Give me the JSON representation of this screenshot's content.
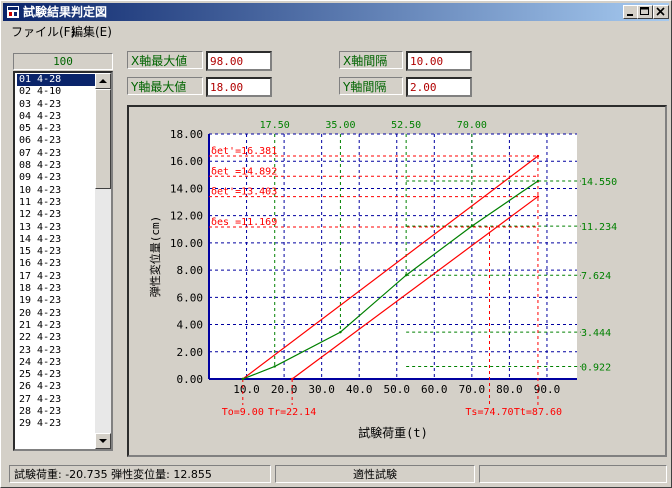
{
  "window": {
    "title": "試験結果判定図"
  },
  "menu": {
    "items": [
      "ファイル(F)",
      "編集(E)"
    ]
  },
  "counter": "100",
  "list": {
    "selected_index": 0,
    "items": [
      "01 4-28",
      "02 4-10",
      "03 4-23",
      "04 4-23",
      "05 4-23",
      "06 4-23",
      "07 4-23",
      "08 4-23",
      "09 4-23",
      "10 4-23",
      "11 4-23",
      "12 4-23",
      "13 4-23",
      "14 4-23",
      "15 4-23",
      "16 4-23",
      "17 4-23",
      "18 4-23",
      "19 4-23",
      "20 4-23",
      "21 4-23",
      "22 4-23",
      "23 4-23",
      "24 4-23",
      "25 4-23",
      "26 4-23",
      "27 4-23",
      "28 4-23",
      "29 4-23"
    ]
  },
  "params": {
    "x_max_label": "X軸最大値",
    "x_max_value": "98.00",
    "y_max_label": "Y軸最大値",
    "y_max_value": "18.00",
    "x_step_label": "X軸間隔",
    "x_step_value": "10.00",
    "y_step_label": "Y軸間隔",
    "y_step_value": "2.00"
  },
  "chart_data": {
    "type": "line",
    "xlabel": "試験荷重(t)",
    "ylabel": "弾性変位量(cm)",
    "xlim": [
      0,
      98
    ],
    "ylim": [
      0,
      18
    ],
    "x_ticks": [
      "10.0",
      "20.0",
      "30.0",
      "40.0",
      "50.0",
      "60.0",
      "70.0",
      "80.0",
      "90.0"
    ],
    "y_ticks": [
      "0.00",
      "2.00",
      "4.00",
      "6.00",
      "8.00",
      "10.00",
      "12.00",
      "14.00",
      "16.00",
      "18.00"
    ],
    "top_ticks": [
      "17.50",
      "35.00",
      "52.50",
      "70.00"
    ],
    "colors": {
      "red": "#ff0000",
      "green": "#008000",
      "grid": "#0000a0",
      "axis": "#0000a0"
    },
    "series": [
      {
        "color": "#ff0000",
        "x": [
          9.0,
          87.6
        ],
        "y": [
          0.0,
          16.381
        ]
      },
      {
        "color": "#ff0000",
        "x": [
          22.14,
          87.6
        ],
        "y": [
          0.0,
          13.403
        ]
      },
      {
        "color": "#008000",
        "x": [
          9.0,
          17.5,
          35.0,
          52.5,
          70.0,
          87.6
        ],
        "y": [
          0.0,
          0.922,
          3.444,
          7.624,
          11.234,
          14.55
        ]
      }
    ],
    "red_left_labels": [
      {
        "text": "δet'=16.381",
        "y": 16.381
      },
      {
        "text": "δet =14.892",
        "y": 14.892
      },
      {
        "text": "δet'=13.403",
        "y": 13.403
      },
      {
        "text": "δes =11.169",
        "y": 11.169
      }
    ],
    "green_right_labels": [
      {
        "text": "14.550",
        "y": 14.55
      },
      {
        "text": "11.234",
        "y": 11.234
      },
      {
        "text": "7.624",
        "y": 7.624
      },
      {
        "text": "3.444",
        "y": 3.444
      },
      {
        "text": "0.922",
        "y": 0.922
      }
    ],
    "bottom_labels": [
      {
        "text": "To=9.00",
        "x": 9.0
      },
      {
        "text": "Tr=22.14",
        "x": 22.14
      },
      {
        "text": "Ts=74.70",
        "x": 74.7
      },
      {
        "text": "Tt=87.60",
        "x": 87.6
      }
    ]
  },
  "status": {
    "readout": "試験荷重: -20.735 弾性変位量: 12.855",
    "mode": "適性試験"
  }
}
